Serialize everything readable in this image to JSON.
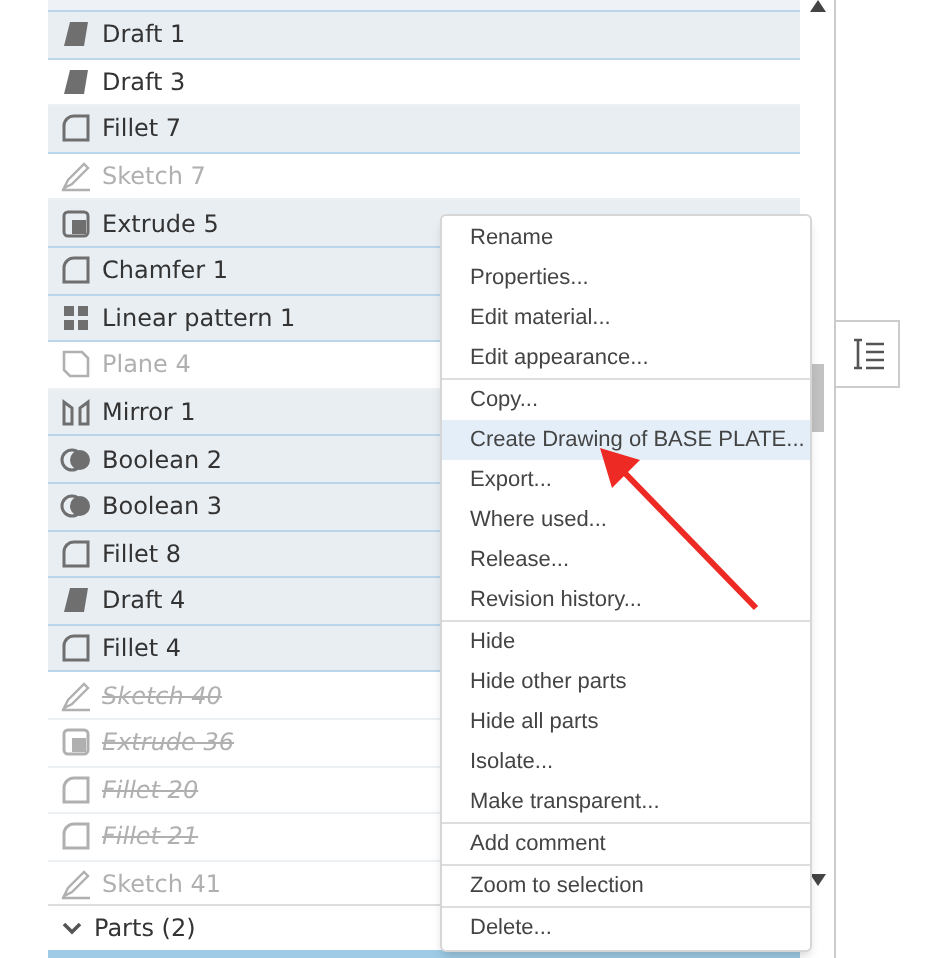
{
  "features": [
    {
      "label": "Draft 1",
      "kind": "draft",
      "selected": true,
      "hidden": false,
      "suppressed": false
    },
    {
      "label": "Draft 3",
      "kind": "draft",
      "selected": false,
      "hidden": false,
      "suppressed": false
    },
    {
      "label": "Fillet 7",
      "kind": "fillet",
      "selected": true,
      "hidden": false,
      "suppressed": false
    },
    {
      "label": "Sketch 7",
      "kind": "sketch",
      "selected": false,
      "hidden": true,
      "suppressed": false
    },
    {
      "label": "Extrude 5",
      "kind": "extrude",
      "selected": true,
      "hidden": false,
      "suppressed": false
    },
    {
      "label": "Chamfer 1",
      "kind": "fillet",
      "selected": true,
      "hidden": false,
      "suppressed": false
    },
    {
      "label": "Linear pattern 1",
      "kind": "pattern",
      "selected": true,
      "hidden": false,
      "suppressed": false
    },
    {
      "label": "Plane 4",
      "kind": "plane",
      "selected": false,
      "hidden": true,
      "suppressed": false
    },
    {
      "label": "Mirror 1",
      "kind": "mirror",
      "selected": true,
      "hidden": false,
      "suppressed": false
    },
    {
      "label": "Boolean 2",
      "kind": "boolean",
      "selected": true,
      "hidden": false,
      "suppressed": false
    },
    {
      "label": "Boolean 3",
      "kind": "boolean",
      "selected": true,
      "hidden": false,
      "suppressed": false
    },
    {
      "label": "Fillet 8",
      "kind": "fillet",
      "selected": true,
      "hidden": false,
      "suppressed": false
    },
    {
      "label": "Draft 4",
      "kind": "draft",
      "selected": true,
      "hidden": false,
      "suppressed": false
    },
    {
      "label": "Fillet 4",
      "kind": "fillet",
      "selected": true,
      "hidden": false,
      "suppressed": false
    },
    {
      "label": "Sketch 40",
      "kind": "sketch",
      "selected": false,
      "hidden": true,
      "suppressed": true
    },
    {
      "label": "Extrude 36",
      "kind": "extrude",
      "selected": false,
      "hidden": true,
      "suppressed": true
    },
    {
      "label": "Fillet 20",
      "kind": "fillet",
      "selected": false,
      "hidden": true,
      "suppressed": true
    },
    {
      "label": "Fillet 21",
      "kind": "fillet",
      "selected": false,
      "hidden": true,
      "suppressed": true
    },
    {
      "label": "Sketch 41",
      "kind": "sketch",
      "selected": false,
      "hidden": true,
      "suppressed": false
    }
  ],
  "parts_section": {
    "label": "Parts (2)",
    "expanded": true
  },
  "context_menu": [
    [
      {
        "label": "Rename",
        "selected": false
      },
      {
        "label": "Properties...",
        "selected": false
      },
      {
        "label": "Edit material...",
        "selected": false
      },
      {
        "label": "Edit appearance...",
        "selected": false
      }
    ],
    [
      {
        "label": "Copy...",
        "selected": false
      },
      {
        "label": "Create Drawing of BASE PLATE...",
        "selected": true
      },
      {
        "label": "Export...",
        "selected": false
      },
      {
        "label": "Where used...",
        "selected": false
      },
      {
        "label": "Release...",
        "selected": false
      },
      {
        "label": "Revision history...",
        "selected": false
      }
    ],
    [
      {
        "label": "Hide",
        "selected": false
      },
      {
        "label": "Hide other parts",
        "selected": false
      },
      {
        "label": "Hide all parts",
        "selected": false
      },
      {
        "label": "Isolate...",
        "selected": false
      },
      {
        "label": "Make transparent...",
        "selected": false
      }
    ],
    [
      {
        "label": "Add comment",
        "selected": false
      }
    ],
    [
      {
        "label": "Zoom to selection",
        "selected": false
      }
    ],
    [
      {
        "label": "Delete...",
        "selected": false
      }
    ]
  ]
}
